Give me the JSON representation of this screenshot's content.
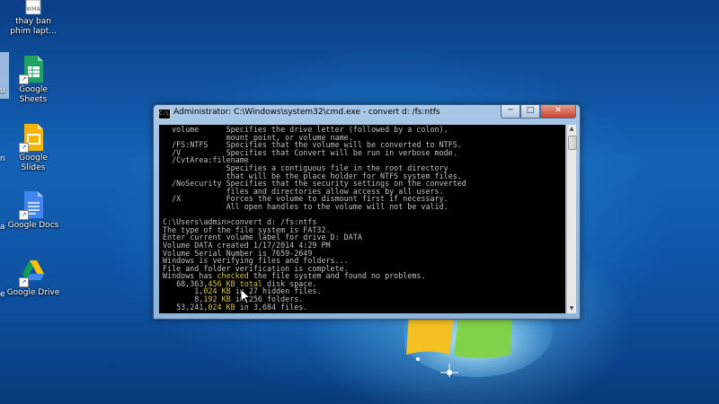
{
  "desktop": {
    "icons": [
      {
        "name": "WMA",
        "label1": "thay ban",
        "label2": "phim lapt..."
      },
      {
        "name": "Google Sheets",
        "label1": "Google",
        "label2": "Sheets"
      },
      {
        "name": "Google Slides",
        "label1": "Google Slides",
        "label2": ""
      },
      {
        "name": "Google Docs",
        "label1": "Google Docs",
        "label2": ""
      },
      {
        "name": "Google Drive",
        "label1": "Google Drive",
        "label2": ""
      }
    ],
    "left_labels": [
      "u",
      "n",
      "a",
      "e"
    ],
    "colors": {
      "sheets": "#1ea362",
      "slides": "#f4b400",
      "docs": "#4285f4",
      "drive_yellow": "#f4c20d",
      "drive_green": "#0f9d58",
      "drive_blue": "#4285f4"
    }
  },
  "window": {
    "icon": "C:\\",
    "title": "Administrator: C:\\Windows\\system32\\cmd.exe - convert  d: /fs:ntfs",
    "min": "─",
    "max": "□",
    "close": "✕"
  },
  "console": {
    "lines": [
      "  volume      Specifies the drive letter (followed by a colon),",
      "              mount point, or volume name.",
      "  /FS:NTFS    Specifies that the volume will be converted to NTFS.",
      "  /V          Specifies that Convert will be run in verbose mode.",
      "  /CvtArea:filename",
      "              Specifies a contiguous file in the root directory",
      "              that will be the place holder for NTFS system files.",
      "  /NoSecurity Specifies that the security settings on the converted",
      "              files and directories allow access by all users.",
      "  /X          Forces the volume to dismount first if necessary.",
      "              All open handles to the volume will not be valid.",
      "",
      "C:\\Users\\admin>convert d: /fs:ntfs",
      "The type of the file system is FAT32.",
      "Enter current volume label for drive D: DATA",
      "Volume DATA created 1/17/2014 4:29 PM",
      "Volume Serial Number is 7659-2649",
      "Windows is verifying files and folders...",
      "File and folder verification is complete."
    ],
    "checked_line": {
      "pre": "Windows has ",
      "hl": "checked",
      "post": " the file system and found no problems."
    },
    "stats": [
      {
        "pre": "   68,363,",
        "hl1": "456",
        "mid": " ",
        "hl2": "KB total",
        "post": " disk space."
      },
      {
        "pre": "       1,",
        "hl1": "024",
        "mid": " ",
        "hl2": "KB",
        "post": " in 27 hidden files."
      },
      {
        "pre": "       8,",
        "hl1": "192",
        "mid": " ",
        "hl2": "KB",
        "post": " in 256 folders."
      },
      {
        "pre": "   53,241,",
        "hl1": "024",
        "mid": " ",
        "hl2": "KB",
        "post": " in 3,684 files."
      }
    ]
  }
}
